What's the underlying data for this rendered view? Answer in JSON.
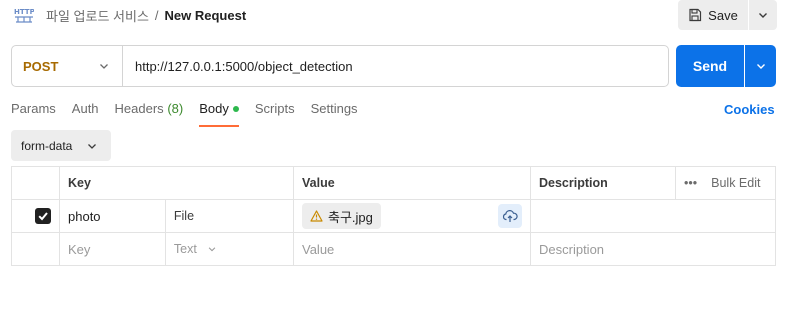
{
  "header": {
    "icon_text": "HTTP",
    "collection": "파일 업로드 서비스",
    "separator": "/",
    "request_name": "New Request",
    "save_label": "Save"
  },
  "request": {
    "method": "POST",
    "url": "http://127.0.0.1:5000/object_detection",
    "send_label": "Send"
  },
  "tabs": {
    "params": "Params",
    "auth": "Auth",
    "headers": "Headers",
    "headers_count": "(8)",
    "body": "Body",
    "scripts": "Scripts",
    "settings": "Settings",
    "cookies": "Cookies"
  },
  "body_type": "form-data",
  "table": {
    "headers": {
      "key": "Key",
      "value": "Value",
      "description": "Description",
      "bulk_edit": "Bulk Edit",
      "more": "•••"
    },
    "rows": [
      {
        "checked": true,
        "key": "photo",
        "type": "File",
        "value": "축구.jpg",
        "description": ""
      }
    ],
    "new_row": {
      "key_placeholder": "Key",
      "type": "Text",
      "value_placeholder": "Value",
      "description_placeholder": "Description"
    }
  },
  "colors": {
    "method": "#a76a00",
    "send": "#0c72e8",
    "active_tab_underline": "#ff6c37",
    "body_dot": "#2db84d",
    "warning": "#c98a00"
  }
}
